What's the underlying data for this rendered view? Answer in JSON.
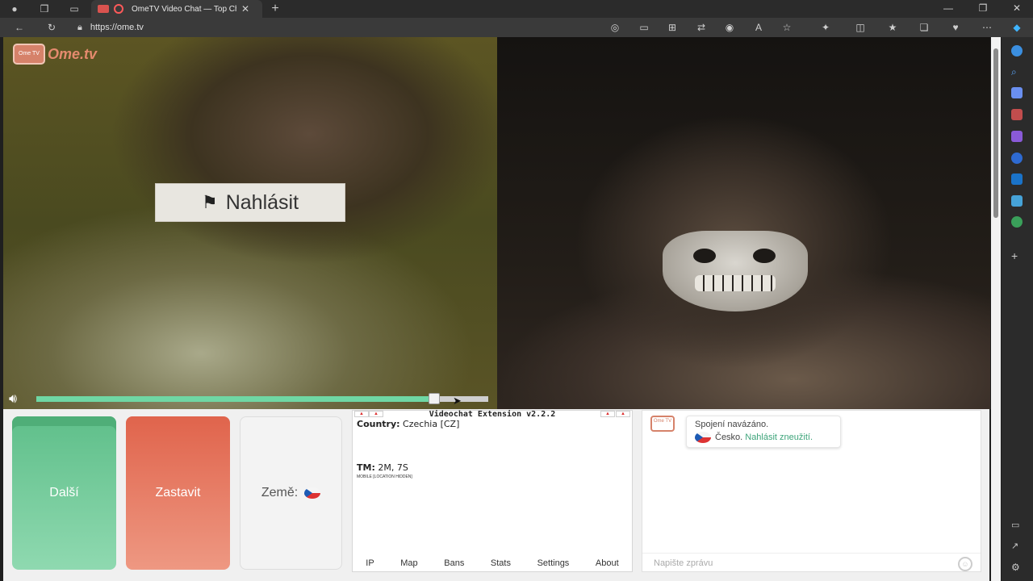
{
  "tab": {
    "title": "OmeTV Video Chat — Top Chat",
    "close": "✕",
    "new": "+"
  },
  "address": {
    "url": "https://ome.tv"
  },
  "video": {
    "logo_small": "Ome TV",
    "logo_word": "Ome.tv",
    "report_label": "Nahlásit",
    "volume_level": 0.88
  },
  "controls": {
    "next": "Další",
    "stop": "Zastavit",
    "country": "Země:"
  },
  "extension": {
    "title": "Videochat Extension v2.2.2",
    "country_label": "Country:",
    "country_value": "Czechia [CZ]",
    "tm_label": "TM:",
    "tm_value": "2M, 7S",
    "mobile_note": "MOBILE [LOCATION HIDDEN]",
    "tabs": [
      "IP",
      "Map",
      "Bans",
      "Stats",
      "Settings",
      "About"
    ]
  },
  "chat": {
    "avatar": "Ome TV",
    "status": "Spojení navázáno.",
    "country": "Česko.",
    "report_link": "Nahlásit zneužití.",
    "placeholder": "Napište zprávu"
  },
  "window": {
    "minimize": "—",
    "maximize": "❐",
    "close": "✕"
  }
}
